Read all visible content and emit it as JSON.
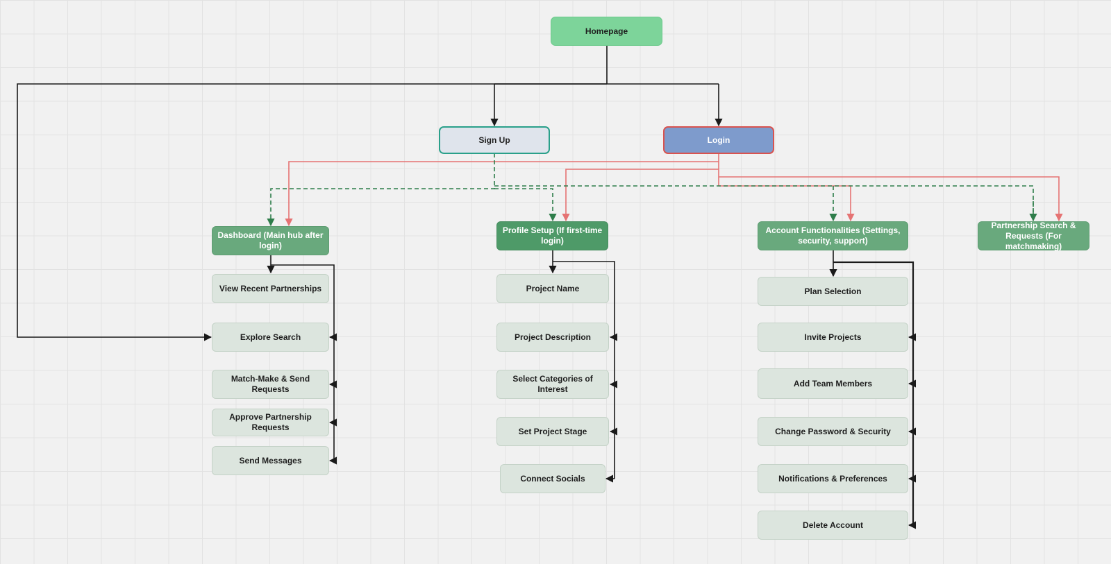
{
  "diagram": {
    "homepage": "Homepage",
    "signup": "Sign Up",
    "login": "Login",
    "dashboard": {
      "title": "Dashboard (Main hub after login)",
      "items": [
        "View Recent Partnerships",
        "Explore Search",
        "Match-Make & Send Requests",
        "Approve Partnership Requests",
        "Send Messages"
      ]
    },
    "profile": {
      "title": "Profile Setup (If first-time login)",
      "items": [
        "Project Name",
        "Project Description",
        "Select Categories of Interest",
        "Set Project Stage",
        "Connect Socials"
      ]
    },
    "account": {
      "title": "Account Functionalities (Settings, security, support)",
      "items": [
        "Plan Selection",
        "Invite Projects",
        "Add Team Members",
        "Change Password & Security",
        "Notifications & Preferences",
        "Delete Account"
      ]
    },
    "partnership": {
      "title": "Partnership Search & Requests (For matchmaking)"
    }
  },
  "colors": {
    "connector": "#1a1a1a",
    "login_connector": "#e57373",
    "signup_connector": "#2e7d4a",
    "homepage_fill": "#7dd49a",
    "login_fill": "#7e9bcc",
    "hub_fill": "#69a97d",
    "item_fill": "#dce5de"
  }
}
